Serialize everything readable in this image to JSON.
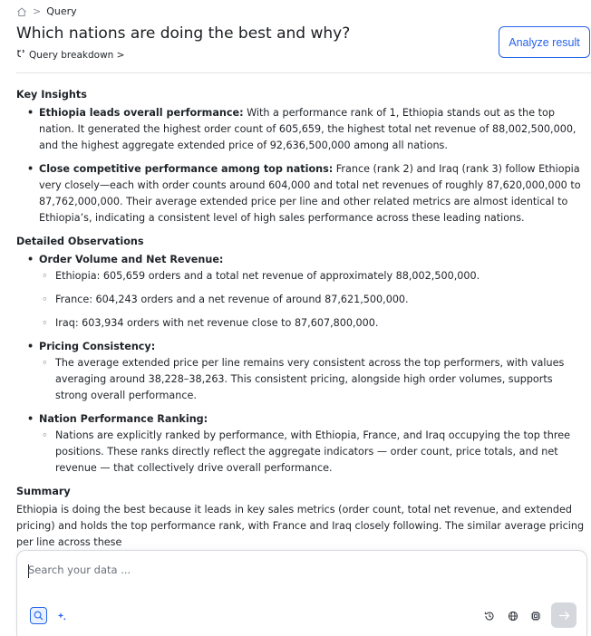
{
  "breadcrumb": {
    "current": "Query"
  },
  "page": {
    "title": "Which nations are doing the best and why?",
    "breakdown_label": "Query breakdown >",
    "analyze_label": "Analyze result"
  },
  "content": {
    "key_insights": {
      "heading": "Key Insights",
      "items": [
        {
          "lead": "Ethiopia leads overall performance:",
          "text": " With a performance rank of 1, Ethiopia stands out as the top nation. It generated the highest order count of 605,659, the highest total net revenue of 88,002,500,000, and the highest aggregate extended price of 92,636,500,000 among all nations."
        },
        {
          "lead": "Close competitive performance among top nations:",
          "text": " France (rank 2) and Iraq (rank 3) follow Ethiopia very closely—each with order counts around 604,000 and total net revenues of roughly 87,620,000,000 to 87,762,000,000. Their average extended price per line and other related metrics are almost identical to Ethiopia’s, indicating a consistent level of high sales performance across these leading nations."
        }
      ]
    },
    "detailed": {
      "heading": "Detailed Observations",
      "groups": [
        {
          "title": "Order Volume and Net Revenue:",
          "items": [
            "Ethiopia: 605,659 orders and a total net revenue of approximately 88,002,500,000.",
            "France: 604,243 orders and a net revenue of around 87,621,500,000.",
            "Iraq: 603,934 orders with net revenue close to 87,607,800,000."
          ]
        },
        {
          "title": "Pricing Consistency:",
          "items": [
            "The average extended price per line remains very consistent across the top performers, with values averaging around 38,228–38,263. This consistent pricing, alongside high order volumes, supports strong overall performance."
          ]
        },
        {
          "title": "Nation Performance Ranking:",
          "items": [
            "Nations are explicitly ranked by performance, with Ethiopia, France, and Iraq occupying the top three positions. These ranks directly reflect the aggregate indicators — order count, price totals, and net revenue — that collectively drive overall performance."
          ]
        }
      ]
    },
    "summary": {
      "heading": "Summary",
      "text": "Ethiopia is doing the best because it leads in key sales metrics (order count, total net revenue, and extended pricing) and holds the top performance rank, with France and Iraq closely following. The similar average pricing per line across these"
    }
  },
  "search": {
    "placeholder": "Search your data ..."
  },
  "colors": {
    "accent": "#2563eb",
    "send_disabled": "#d4d7dc"
  }
}
